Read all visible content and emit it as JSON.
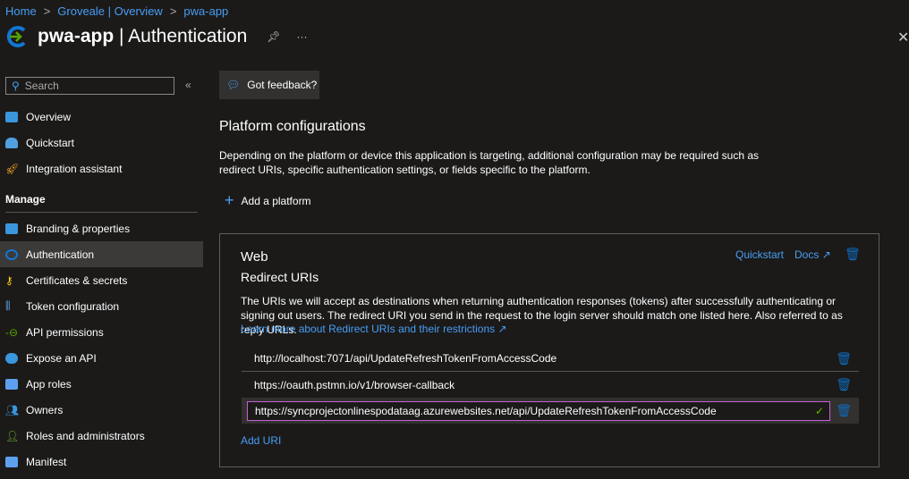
{
  "breadcrumb": [
    "Home",
    "Groveale | Overview",
    "pwa-app"
  ],
  "header": {
    "app": "pwa-app",
    "page": "| Authentication",
    "more": "···"
  },
  "search": {
    "placeholder": "Search"
  },
  "nav": {
    "top": [
      {
        "label": "Overview",
        "color": "#3a96dd"
      },
      {
        "label": "Quickstart",
        "color": "#50a0e0"
      },
      {
        "label": "Integration assistant",
        "color": "#f7a325"
      }
    ],
    "section": "Manage",
    "manage": [
      {
        "label": "Branding & properties",
        "color": "#3a96dd"
      },
      {
        "label": "Authentication",
        "color": "#0f78d4"
      },
      {
        "label": "Certificates & secrets",
        "color": "#fcd116"
      },
      {
        "label": "Token configuration",
        "color": "#5ea0ef"
      },
      {
        "label": "API permissions",
        "color": "#57a300"
      },
      {
        "label": "Expose an API",
        "color": "#3a96dd"
      },
      {
        "label": "App roles",
        "color": "#5ea0ef"
      },
      {
        "label": "Owners",
        "color": "#3a96dd"
      },
      {
        "label": "Roles and administrators",
        "color": "#76bc2d"
      },
      {
        "label": "Manifest",
        "color": "#5ea0ef"
      }
    ]
  },
  "feedback": "Got feedback?",
  "platform": {
    "title": "Platform configurations",
    "description": "Depending on the platform or device this application is targeting, additional configuration may be required such as redirect URIs, specific authentication settings, or fields specific to the platform.",
    "add": "Add a platform"
  },
  "web": {
    "title": "Web",
    "subtitle": "Redirect URIs",
    "quickstart": "Quickstart",
    "docs": "Docs",
    "description": "The URIs we will accept as destinations when returning authentication responses (tokens) after successfully authenticating or signing out users. The redirect URI you send in the request to the login server should match one listed here. Also referred to as reply URLs.",
    "learn": "Learn more about Redirect URIs and their restrictions",
    "uris": [
      "http://localhost:7071/api/UpdateRefreshTokenFromAccessCode",
      "https://oauth.pstmn.io/v1/browser-callback"
    ],
    "editing": "https://syncprojectonlinespodataag.azurewebsites.net/api/UpdateRefreshTokenFromAccessCode",
    "add_uri": "Add URI"
  }
}
